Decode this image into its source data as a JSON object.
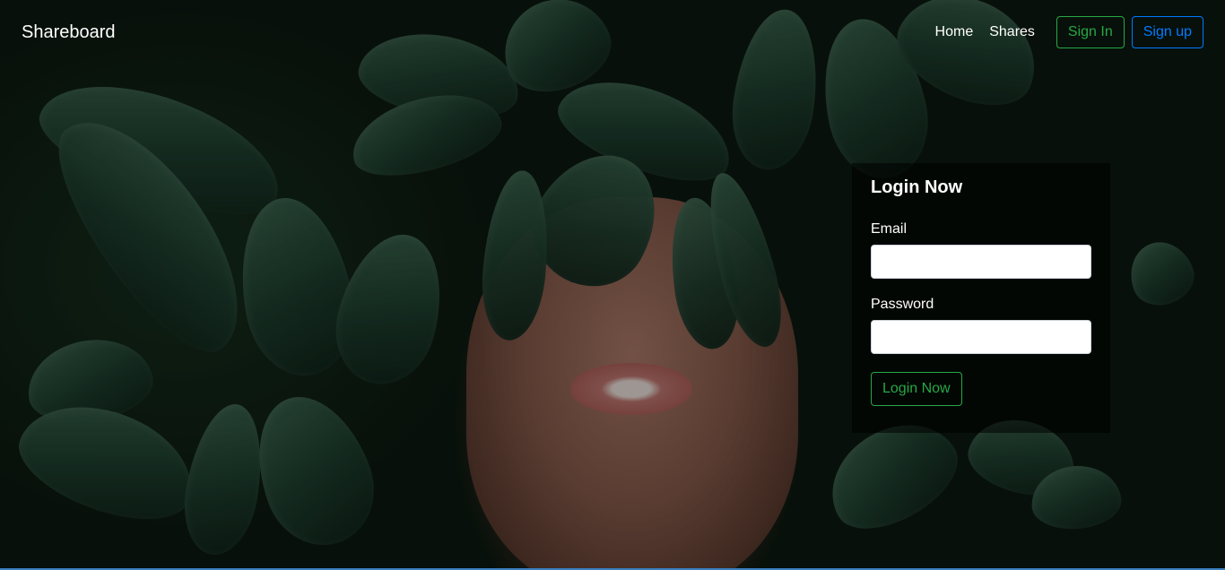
{
  "navbar": {
    "brand": "Shareboard",
    "links": [
      "Home",
      "Shares"
    ],
    "signin_label": "Sign In",
    "signup_label": "Sign up"
  },
  "login": {
    "title": "Login Now",
    "email_label": "Email",
    "email_value": "",
    "password_label": "Password",
    "password_value": "",
    "submit_label": "Login Now"
  },
  "colors": {
    "success": "#28a745",
    "primary": "#007bff"
  }
}
